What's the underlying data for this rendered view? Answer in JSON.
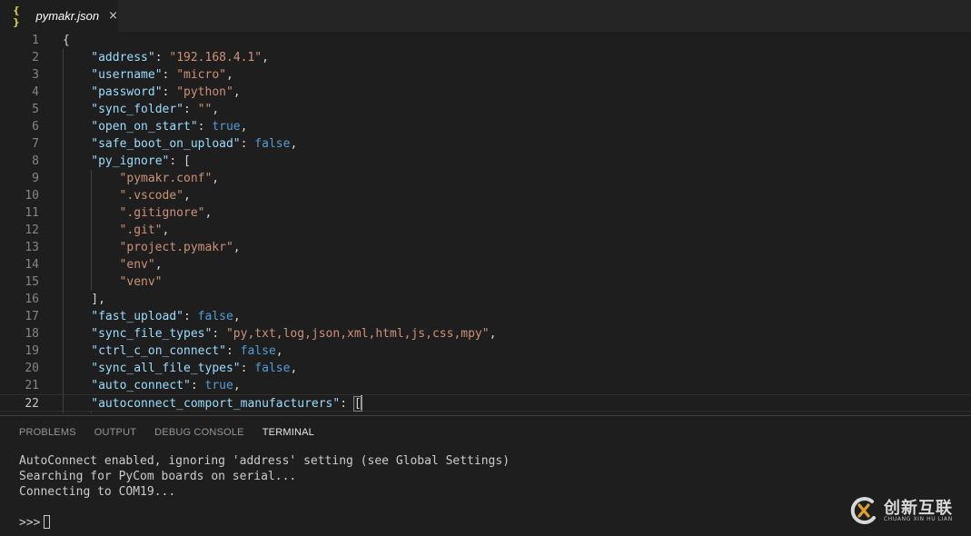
{
  "tab": {
    "icon": "{ }",
    "label": "pymakr.json",
    "close": "×"
  },
  "editor": {
    "current_line": 22,
    "lines": [
      {
        "n": "1",
        "tokens": [
          {
            "t": "p",
            "v": "{"
          }
        ]
      },
      {
        "n": "2",
        "tokens": [
          {
            "t": "k",
            "v": "\"address\""
          },
          {
            "t": "p",
            "v": ": "
          },
          {
            "t": "s",
            "v": "\"192.168.4.1\""
          },
          {
            "t": "p",
            "v": ","
          }
        ]
      },
      {
        "n": "3",
        "tokens": [
          {
            "t": "k",
            "v": "\"username\""
          },
          {
            "t": "p",
            "v": ": "
          },
          {
            "t": "s",
            "v": "\"micro\""
          },
          {
            "t": "p",
            "v": ","
          }
        ]
      },
      {
        "n": "4",
        "tokens": [
          {
            "t": "k",
            "v": "\"password\""
          },
          {
            "t": "p",
            "v": ": "
          },
          {
            "t": "s",
            "v": "\"python\""
          },
          {
            "t": "p",
            "v": ","
          }
        ]
      },
      {
        "n": "5",
        "tokens": [
          {
            "t": "k",
            "v": "\"sync_folder\""
          },
          {
            "t": "p",
            "v": ": "
          },
          {
            "t": "s",
            "v": "\"\""
          },
          {
            "t": "p",
            "v": ","
          }
        ]
      },
      {
        "n": "6",
        "tokens": [
          {
            "t": "k",
            "v": "\"open_on_start\""
          },
          {
            "t": "p",
            "v": ": "
          },
          {
            "t": "b",
            "v": "true"
          },
          {
            "t": "p",
            "v": ","
          }
        ]
      },
      {
        "n": "7",
        "tokens": [
          {
            "t": "k",
            "v": "\"safe_boot_on_upload\""
          },
          {
            "t": "p",
            "v": ": "
          },
          {
            "t": "b",
            "v": "false"
          },
          {
            "t": "p",
            "v": ","
          }
        ]
      },
      {
        "n": "8",
        "tokens": [
          {
            "t": "k",
            "v": "\"py_ignore\""
          },
          {
            "t": "p",
            "v": ": ["
          }
        ]
      },
      {
        "n": "9",
        "tokens": [
          {
            "t": "s",
            "v": "\"pymakr.conf\""
          },
          {
            "t": "p",
            "v": ","
          }
        ]
      },
      {
        "n": "10",
        "tokens": [
          {
            "t": "s",
            "v": "\".vscode\""
          },
          {
            "t": "p",
            "v": ","
          }
        ]
      },
      {
        "n": "11",
        "tokens": [
          {
            "t": "s",
            "v": "\".gitignore\""
          },
          {
            "t": "p",
            "v": ","
          }
        ]
      },
      {
        "n": "12",
        "tokens": [
          {
            "t": "s",
            "v": "\".git\""
          },
          {
            "t": "p",
            "v": ","
          }
        ]
      },
      {
        "n": "13",
        "tokens": [
          {
            "t": "s",
            "v": "\"project.pymakr\""
          },
          {
            "t": "p",
            "v": ","
          }
        ]
      },
      {
        "n": "14",
        "tokens": [
          {
            "t": "s",
            "v": "\"env\""
          },
          {
            "t": "p",
            "v": ","
          }
        ]
      },
      {
        "n": "15",
        "tokens": [
          {
            "t": "s",
            "v": "\"venv\""
          }
        ]
      },
      {
        "n": "16",
        "tokens": [
          {
            "t": "p",
            "v": "],"
          }
        ]
      },
      {
        "n": "17",
        "tokens": [
          {
            "t": "k",
            "v": "\"fast_upload\""
          },
          {
            "t": "p",
            "v": ": "
          },
          {
            "t": "b",
            "v": "false"
          },
          {
            "t": "p",
            "v": ","
          }
        ]
      },
      {
        "n": "18",
        "tokens": [
          {
            "t": "k",
            "v": "\"sync_file_types\""
          },
          {
            "t": "p",
            "v": ": "
          },
          {
            "t": "s",
            "v": "\"py,txt,log,json,xml,html,js,css,mpy\""
          },
          {
            "t": "p",
            "v": ","
          }
        ]
      },
      {
        "n": "19",
        "tokens": [
          {
            "t": "k",
            "v": "\"ctrl_c_on_connect\""
          },
          {
            "t": "p",
            "v": ": "
          },
          {
            "t": "b",
            "v": "false"
          },
          {
            "t": "p",
            "v": ","
          }
        ]
      },
      {
        "n": "20",
        "tokens": [
          {
            "t": "k",
            "v": "\"sync_all_file_types\""
          },
          {
            "t": "p",
            "v": ": "
          },
          {
            "t": "b",
            "v": "false"
          },
          {
            "t": "p",
            "v": ","
          }
        ]
      },
      {
        "n": "21",
        "tokens": [
          {
            "t": "k",
            "v": "\"auto_connect\""
          },
          {
            "t": "p",
            "v": ": "
          },
          {
            "t": "b",
            "v": "true"
          },
          {
            "t": "p",
            "v": ","
          }
        ]
      },
      {
        "n": "22",
        "tokens": [
          {
            "t": "k",
            "v": "\"autoconnect_comport_manufacturers\""
          },
          {
            "t": "p",
            "v": ": "
          },
          {
            "t": "p",
            "v": "[",
            "hl": true
          }
        ]
      }
    ]
  },
  "panel": {
    "tabs": [
      {
        "label": "PROBLEMS",
        "active": false
      },
      {
        "label": "OUTPUT",
        "active": false
      },
      {
        "label": "DEBUG CONSOLE",
        "active": false
      },
      {
        "label": "TERMINAL",
        "active": true
      }
    ],
    "terminal_lines": [
      "AutoConnect enabled, ignoring 'address' setting (see Global Settings)",
      "Searching for PyCom boards on serial...",
      "Connecting to COM19..."
    ],
    "prompt": ">>>"
  },
  "watermark": {
    "text": "创新互联",
    "subtext": "CHUANG XIN HU LIAN"
  },
  "colors": {
    "key": "#9cdcfe",
    "string": "#ce9178",
    "boolean": "#569cd6",
    "punctuation": "#d4d4d4",
    "background": "#1e1e1e",
    "tab_icon": "#cbcb41"
  }
}
